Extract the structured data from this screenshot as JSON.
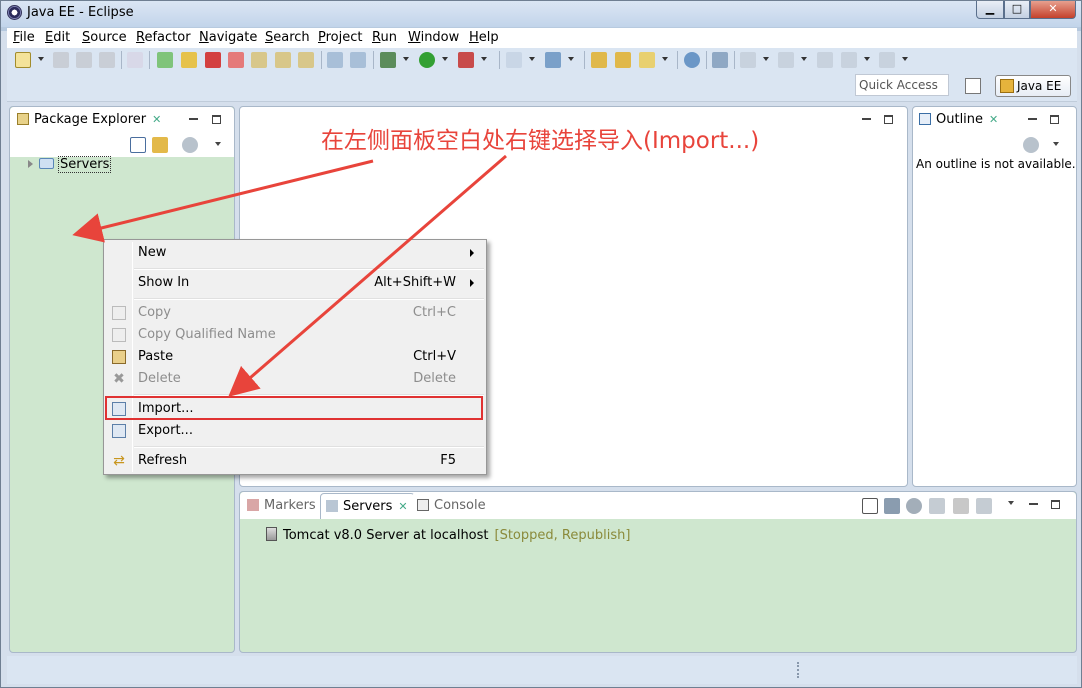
{
  "window": {
    "title": "Java EE - Eclipse",
    "minimize": "▁",
    "maximize": "□",
    "close": "✕"
  },
  "menu": [
    "File",
    "Edit",
    "Source",
    "Refactor",
    "Navigate",
    "Search",
    "Project",
    "Run",
    "Window",
    "Help"
  ],
  "toolbar": {
    "quick_access_placeholder": "Quick Access",
    "perspective_label": "Java EE"
  },
  "package_explorer": {
    "tab_label": "Package Explorer",
    "close": "✕",
    "tree": [
      {
        "label": "Servers",
        "icon": "folder-icon"
      }
    ]
  },
  "context_menu": {
    "items": [
      {
        "label": "New",
        "accel": "",
        "submenu": true,
        "disabled": false,
        "icon": ""
      },
      {
        "label": "Show In",
        "accel": "Alt+Shift+W",
        "submenu": true,
        "disabled": false,
        "icon": ""
      },
      {
        "label": "Copy",
        "accel": "Ctrl+C",
        "submenu": false,
        "disabled": true,
        "icon": "copy-icon"
      },
      {
        "label": "Copy Qualified Name",
        "accel": "",
        "submenu": false,
        "disabled": true,
        "icon": "copy-qualified-icon"
      },
      {
        "label": "Paste",
        "accel": "Ctrl+V",
        "submenu": false,
        "disabled": false,
        "icon": "paste-icon"
      },
      {
        "label": "Delete",
        "accel": "Delete",
        "submenu": false,
        "disabled": true,
        "icon": "delete-icon"
      },
      {
        "label": "Import...",
        "accel": "",
        "submenu": false,
        "disabled": false,
        "icon": "import-icon"
      },
      {
        "label": "Export...",
        "accel": "",
        "submenu": false,
        "disabled": false,
        "icon": "export-icon"
      },
      {
        "label": "Refresh",
        "accel": "F5",
        "submenu": false,
        "disabled": false,
        "icon": "refresh-icon"
      }
    ]
  },
  "annotation": {
    "text": "在左侧面板空白处右键选择导入(Import...)",
    "color": "#e8443b"
  },
  "outline": {
    "tab_label": "Outline",
    "close": "✕",
    "message": "An outline is not available."
  },
  "bottom_panel": {
    "tabs": [
      {
        "label": "Markers",
        "active": false
      },
      {
        "label": "Servers",
        "active": true,
        "close": "✕"
      },
      {
        "label": "Console",
        "active": false
      }
    ],
    "server": {
      "name": "Tomcat v8.0 Server at localhost",
      "status": "[Stopped, Republish]"
    }
  },
  "colors": {
    "panel_green": "#cfe7cf",
    "highlight_red": "#e03232"
  }
}
